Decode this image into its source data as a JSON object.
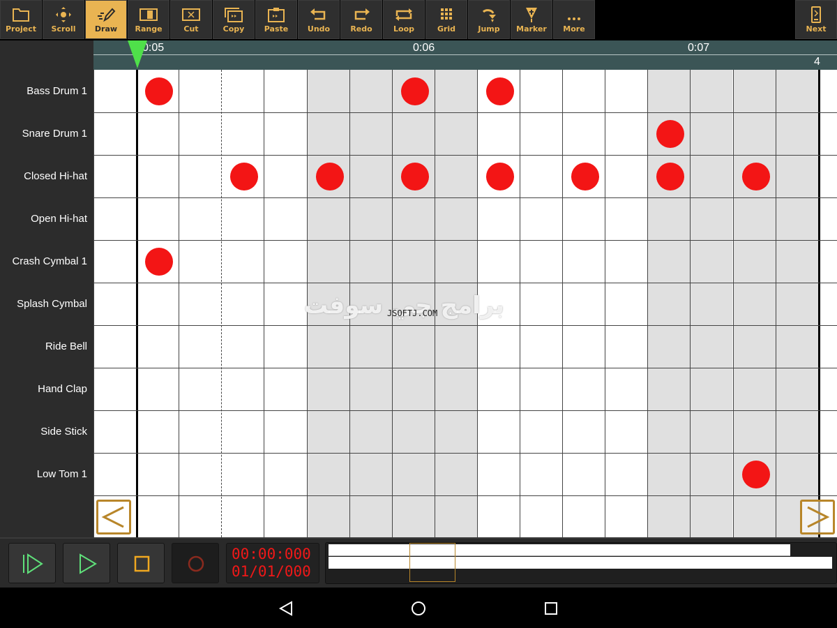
{
  "toolbar": {
    "items": [
      {
        "label": "Project",
        "icon": "folder-icon",
        "active": false
      },
      {
        "label": "Scroll",
        "icon": "scroll-icon",
        "active": false
      },
      {
        "label": "Draw",
        "icon": "pencil-icon",
        "active": true
      },
      {
        "label": "Range",
        "icon": "range-icon",
        "active": false
      },
      {
        "label": "Cut",
        "icon": "scissors-icon",
        "active": false
      },
      {
        "label": "Copy",
        "icon": "copy-icon",
        "active": false
      },
      {
        "label": "Paste",
        "icon": "paste-icon",
        "active": false
      },
      {
        "label": "Undo",
        "icon": "undo-icon",
        "active": false
      },
      {
        "label": "Redo",
        "icon": "redo-icon",
        "active": false
      },
      {
        "label": "Loop",
        "icon": "loop-icon",
        "active": false
      },
      {
        "label": "Grid",
        "icon": "grid-icon",
        "active": false
      },
      {
        "label": "Jump",
        "icon": "jump-icon",
        "active": false
      },
      {
        "label": "Marker",
        "icon": "marker-icon",
        "active": false
      },
      {
        "label": "More",
        "icon": "more-icon",
        "active": false
      }
    ],
    "next": {
      "label": "Next",
      "icon": "next-icon"
    }
  },
  "ruler": {
    "times": [
      "0:05",
      "0:06",
      "0:07"
    ],
    "bar": "4"
  },
  "tracks": [
    {
      "name": "Bass Drum 1",
      "steps": [
        1,
        7,
        9
      ]
    },
    {
      "name": "Snare Drum 1",
      "steps": [
        13
      ]
    },
    {
      "name": "Closed Hi-hat",
      "steps": [
        3,
        5,
        7,
        9,
        11,
        13,
        15
      ]
    },
    {
      "name": "Open Hi-hat",
      "steps": []
    },
    {
      "name": "Crash Cymbal 1",
      "steps": [
        1
      ]
    },
    {
      "name": "Splash Cymbal",
      "steps": []
    },
    {
      "name": "Ride Bell",
      "steps": []
    },
    {
      "name": "Hand Clap",
      "steps": []
    },
    {
      "name": "Side Stick",
      "steps": []
    },
    {
      "name": "Low Tom 1",
      "steps": [
        15
      ]
    }
  ],
  "watermark": {
    "arabic": "برامج جي سوفت",
    "latin": "JSOFTJ.COM"
  },
  "transport": {
    "time": "00:00:000",
    "position": "01/01/000"
  },
  "colors": {
    "accent": "#e9b452",
    "note": "#f31515",
    "play": "#5fe07a",
    "record": "#8a2a1e"
  }
}
